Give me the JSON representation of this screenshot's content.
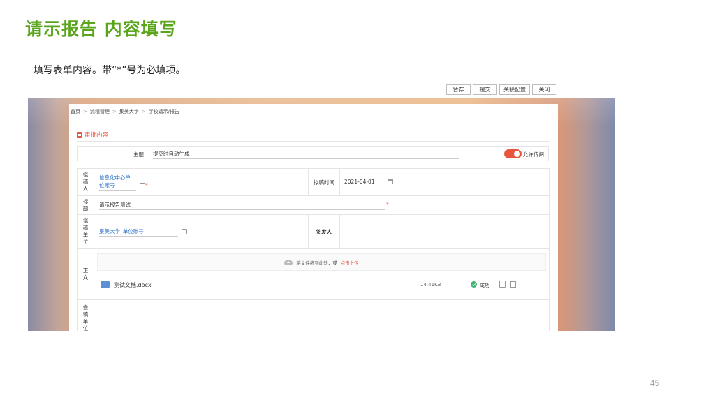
{
  "slide": {
    "title": "请示报告 内容填写",
    "description": "填写表单内容。带“*”号为必填项。",
    "page_number": "45"
  },
  "toolbar": {
    "save_draft": "暂存",
    "submit": "提交",
    "link_config": "关联配置",
    "close": "关闭"
  },
  "breadcrumb": [
    "首页",
    "流程管理",
    "集美大学",
    "学校请示/报告"
  ],
  "section": {
    "title": "审批内容"
  },
  "subject": {
    "label": "主题",
    "value": "提交时自动生成",
    "toggle_label": "允许传阅",
    "toggle_on": true
  },
  "form": {
    "drafter": {
      "label": "拟稿人",
      "value_line1": "信息化中心单",
      "value_line2": "位账号"
    },
    "draft_time": {
      "label": "拟稿时间",
      "value": "2021-04-01"
    },
    "title_row": {
      "label": "标题",
      "value": "请示报告测试"
    },
    "draft_unit": {
      "label": "拟稿单位",
      "value": "集美大学_单位账号"
    },
    "signer": {
      "label": "签发人"
    },
    "body": {
      "label": "正文",
      "upload_text": "将文件拖到此处，或",
      "upload_link": "点击上传",
      "file_name": "测试文档.docx",
      "file_size": "14.41KB",
      "status": "成功"
    },
    "co_unit": {
      "label": "会稿单位"
    }
  },
  "required_mark": "*",
  "colors": {
    "title_green": "#5aa51c",
    "accent_red": "#e8553c",
    "link_blue": "#2a6fc9",
    "success_green": "#3cb371"
  }
}
